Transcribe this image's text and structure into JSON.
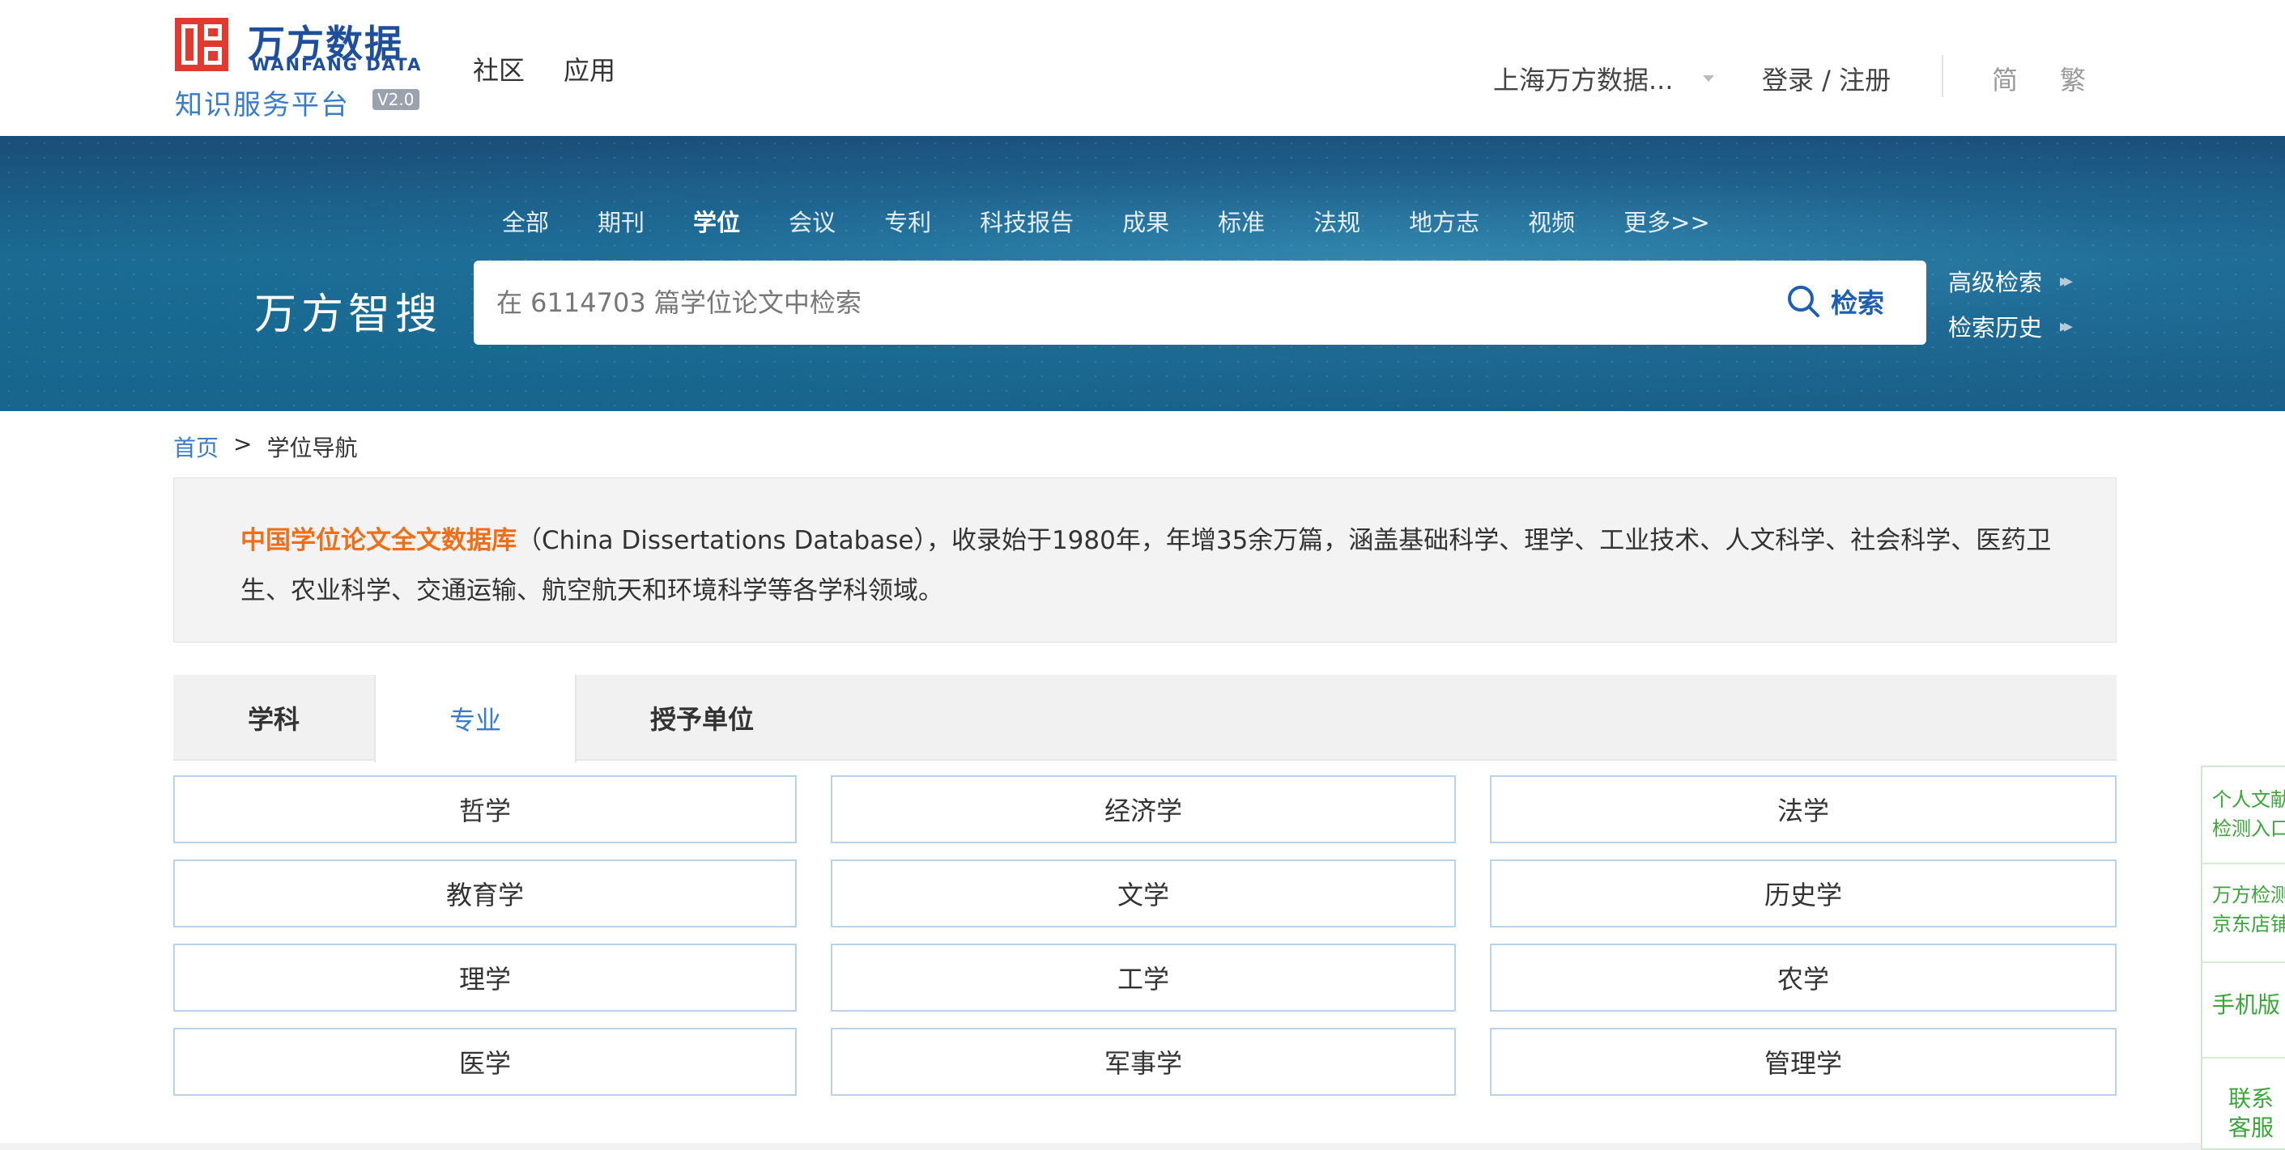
{
  "header": {
    "logo_cn": "万方数据",
    "logo_en": "WANFANG DATA",
    "logo_platform": "知识服务平台",
    "logo_version": "V2.0",
    "nav": [
      "社区",
      "应用"
    ],
    "org_name": "上海万方数据...",
    "login": "登录 / 注册",
    "lang_simplified": "简",
    "lang_traditional": "繁"
  },
  "search": {
    "categories": [
      "全部",
      "期刊",
      "学位",
      "会议",
      "专利",
      "科技报告",
      "成果",
      "标准",
      "法规",
      "地方志",
      "视频",
      "更多>>"
    ],
    "active_category": "学位",
    "brand_label": "万方智搜",
    "placeholder": "在 6114703 篇学位论文中检索",
    "button_label": "检索",
    "advanced": "高级检索",
    "history": "检索历史"
  },
  "breadcrumb": {
    "home": "首页",
    "separator": ">",
    "current": "学位导航"
  },
  "intro": {
    "highlight": "中国学位论文全文数据库",
    "text": "（China Dissertations Database），收录始于1980年，年增35余万篇，涵盖基础科学、理学、工业技术、人文科学、社会科学、医药卫生、农业科学、交通运输、航空航天和环境科学等各学科领域。"
  },
  "tabs": {
    "items": [
      "学科",
      "专业",
      "授予单位"
    ],
    "active": "专业"
  },
  "grid": {
    "items": [
      "哲学",
      "经济学",
      "法学",
      "教育学",
      "文学",
      "历史学",
      "理学",
      "工学",
      "农学",
      "医学",
      "军事学",
      "管理学"
    ]
  },
  "sidefloat": {
    "item1_line1": "个人文献",
    "item1_line2": "检测入口",
    "item2_line1": "万方检测",
    "item2_line2": "京东店铺",
    "item3": "手机版",
    "item4_line1": "联系",
    "item4_line2": "客服"
  },
  "colors": {
    "brand_blue": "#1f4f9c",
    "link_blue": "#3a7cc8",
    "highlight_orange": "#ee6e1a",
    "side_green": "#3aa63a"
  }
}
